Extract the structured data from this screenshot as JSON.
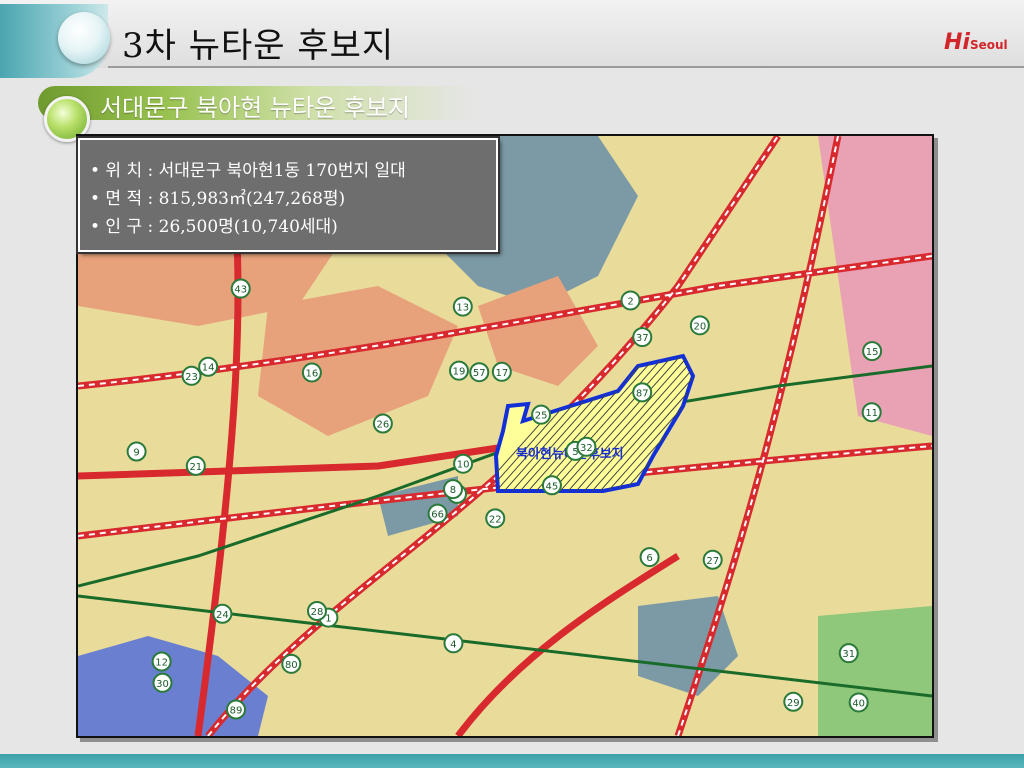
{
  "header": {
    "title": "3차 뉴타운 후보지"
  },
  "logo": {
    "brand": "Hi",
    "sub": "Seoul"
  },
  "section": {
    "title": "서대문구 북아현 뉴타운 후보지"
  },
  "info": {
    "location": "• 위 치 : 서대문구 북아현1동 170번지  일대",
    "area": "• 면 적 : 815,983㎡(247,268평)",
    "population": "• 인 구 : 26,500명(10,740세대)"
  },
  "map": {
    "area_label": "북아현뉴타운후보지",
    "colors": {
      "residential": "#e9dc9b",
      "green": "#e7a27c",
      "water": "#7c9aa6",
      "road": "#d8292e",
      "boundary": "#1230d8",
      "highlight": "#ffff9a",
      "park": "#8fc87a",
      "commercial": "#e9a2b4"
    },
    "route_markers": [
      "22",
      "23",
      "3",
      "12",
      "5",
      "1",
      "2",
      "17",
      "37",
      "45",
      "43",
      "40",
      "21",
      "15",
      "66",
      "87",
      "89",
      "19",
      "25",
      "24",
      "26",
      "30",
      "80",
      "57",
      "32",
      "27",
      "14",
      "13",
      "9",
      "6",
      "11",
      "8",
      "4",
      "10",
      "16",
      "20",
      "28",
      "29",
      "31"
    ]
  }
}
